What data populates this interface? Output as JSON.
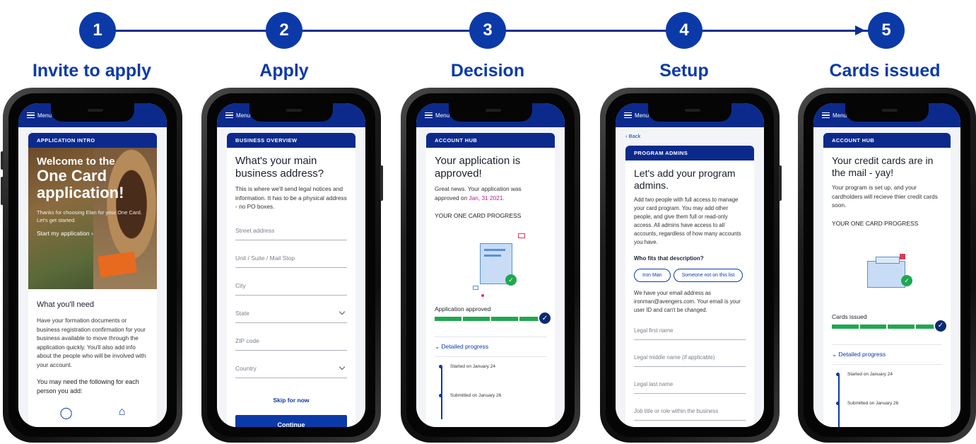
{
  "steps": [
    {
      "number": "1",
      "title": "Invite to apply"
    },
    {
      "number": "2",
      "title": "Apply"
    },
    {
      "number": "3",
      "title": "Decision"
    },
    {
      "number": "4",
      "title": "Setup"
    },
    {
      "number": "5",
      "title": "Cards issued"
    }
  ],
  "menu_label": "Menu",
  "phone1": {
    "section": "APPLICATION INTRO",
    "hero_title_1": "Welcome to the",
    "hero_title_2": "One Card",
    "hero_title_3": "application!",
    "hero_text": "Thanks for choosing Elan for your One Card.",
    "hero_text_2": "Let's get started.",
    "start_link": "Start my application",
    "need_title": "What you'll need",
    "need_text": "Have your formation documents or business registration confirmation for your business available to move through the application quickly. You'll also add info about the people who will be involved with your account.",
    "need_text_2": "You may need the following for each person you add:"
  },
  "phone2": {
    "section": "BUSINESS OVERVIEW",
    "title": "What's your main business address?",
    "text": "This is where we'll send legal notices and information. It has to be a physical address - no PO boxes.",
    "fields": [
      "Street address",
      "Unit / Suite / Mail Stop",
      "City",
      "State",
      "ZIP code",
      "Country"
    ],
    "skip": "Skip for now",
    "continue": "Continue"
  },
  "phone3": {
    "section": "ACCOUNT HUB",
    "title": "Your application is approved!",
    "text": "Great news. Your application was approved on",
    "date": "Jan, 31 2021.",
    "progress_heading": "YOUR ONE CARD PROGRESS",
    "status": "Application approved",
    "detail": "Detailed progress",
    "timeline": [
      "Started on January 24",
      "Submitted on January 26"
    ]
  },
  "phone4": {
    "back": "Back",
    "section": "PROGRAM ADMINS",
    "title": "Let's add your program admins.",
    "text": "Add two people with full access to manage your card program. You may add other people, and give them full or read-only access. All admins have access to all accounts, regardless of how many accounts you have.",
    "question": "Who fits that description?",
    "chips": [
      "Iron Man",
      "Someone not on this list"
    ],
    "email_text": "We have your email address as ironman@avengers.com. Your email is your user ID and can't be changed.",
    "fields": [
      "Legal first name",
      "Legal middle name (if applicable)",
      "Legal last name",
      "Job title or role within the business"
    ]
  },
  "phone5": {
    "section": "ACCOUNT HUB",
    "title": "Your credit cards are in the mail - yay!",
    "text": "Your program is set up, and your cardholders will recieve thier credit cards soon.",
    "progress_heading": "YOUR ONE CARD PROGRESS",
    "status": "Cards issued",
    "detail": "Detailed progress",
    "timeline": [
      "Started on January 24",
      "Submitted on January 26"
    ]
  },
  "colors": {
    "brand_blue": "#0b3aa8",
    "nav_blue": "#0c2a8c",
    "progress_green": "#1fa84f",
    "date_magenta": "#c2188f"
  }
}
